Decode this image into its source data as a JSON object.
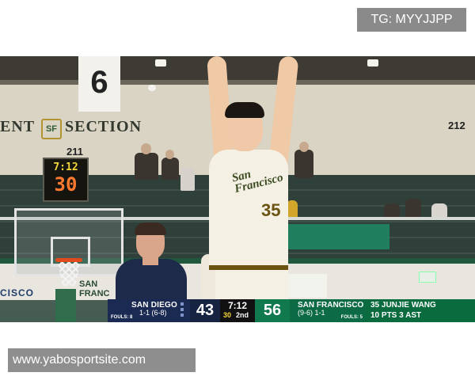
{
  "watermark": {
    "text": "TG: MYYJJPP"
  },
  "footer": {
    "site": "www.yabosportsite.com"
  },
  "arena": {
    "banner_number": "6",
    "section_text": "ENT",
    "section_text_2": "SECTION",
    "logo_letters": "SF",
    "section_left": "211",
    "section_right": "212",
    "floor_text": "CISCO",
    "floor_ad": "SAN\nFRANC"
  },
  "shot_clock": {
    "game_time": "7:12",
    "shot_time": "30"
  },
  "jersey": {
    "team_script": "San\nFrancisco",
    "number": "35"
  },
  "scorebug": {
    "away": {
      "name": "SAN DIEGO",
      "record": "1-1 (6-8)",
      "fouls": "FOULS: 8",
      "score": "43",
      "color": "#1b2a52"
    },
    "clock": {
      "time": "7:12",
      "shot": "30",
      "period": "2nd"
    },
    "home": {
      "name": "SAN FRANCISCO",
      "record": "(9-6) 1-1",
      "fouls": "FOULS: 5",
      "score": "56",
      "color": "#0c6a44"
    },
    "player": {
      "name": "35 JUNJIE WANG",
      "stats": "10 PTS 3 AST"
    }
  }
}
